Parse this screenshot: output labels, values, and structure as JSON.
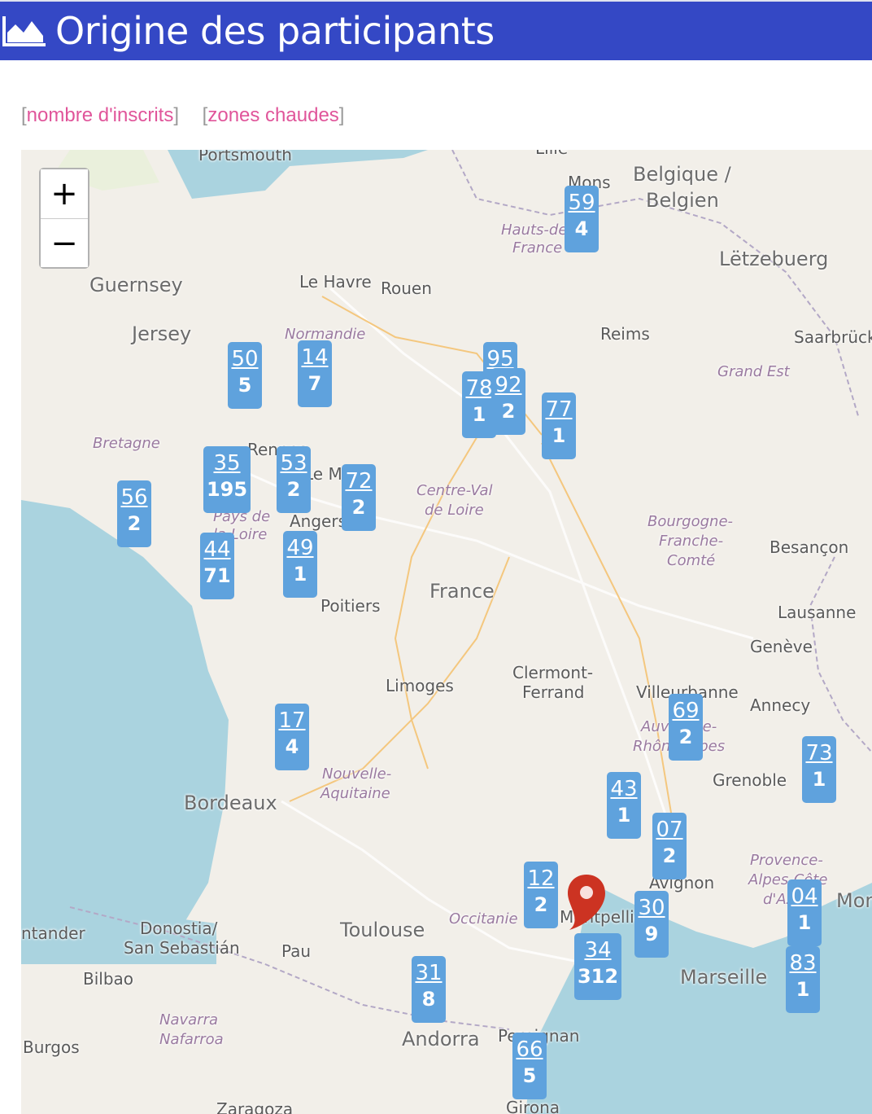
{
  "header": {
    "title": "Origine des participants",
    "icon": "area-chart-icon"
  },
  "filters": {
    "open_bracket": "[",
    "close_bracket": "]",
    "registrations": "nombre d'inscrits",
    "hotspots": "zones chaudes"
  },
  "zoom": {
    "in_label": "+",
    "out_label": "−"
  },
  "map_labels": {
    "portsmouth": "Portsmouth",
    "belgique": "Belgique /",
    "belgien": "Belgien",
    "mons": "Mons",
    "lille": "Lille",
    "guernsey": "Guernsey",
    "jersey": "Jersey",
    "le_havre": "Le Havre",
    "rouen": "Rouen",
    "normandie": "Normandie",
    "hauts_de": "Hauts-de-",
    "france_region": "France",
    "reims": "Reims",
    "letzebuerg": "Lëtzebuerg",
    "saarbrucken": "Saarbrück",
    "grand_est": "Grand Est",
    "bretagne": "Bretagne",
    "rennes": "Rennes",
    "le_mans": "Le Mans",
    "pays_de": "Pays de",
    "la_loire": "la Loire",
    "angers": "Angers",
    "centre_val": "Centre-Val",
    "de_loire": "de Loire",
    "bourgogne": "Bourgogne-",
    "franche": "Franche-",
    "comte": "Comté",
    "besancon": "Besançon",
    "poitiers": "Poitiers",
    "france": "France",
    "lausanne": "Lausanne",
    "geneve": "Genève",
    "limoges": "Limoges",
    "clermont": "Clermont-",
    "ferrand": "Ferrand",
    "villeurbanne": "Villeurbanne",
    "annecy": "Annecy",
    "auvergne": "Auvergne-",
    "rhone_alpes": "Rhône-Alpes",
    "nouvelle": "Nouvelle-",
    "aquitaine": "Aquitaine",
    "grenoble": "Grenoble",
    "bordeaux": "Bordeaux",
    "avignon": "Avignon",
    "provence": "Provence-",
    "alpes_cote": "Alpes-Côte",
    "dazur": "d'Azur",
    "monaco": "Mon",
    "santander": "ntander",
    "donostia": "Donostia/",
    "san_sebastian": "San Sebastián",
    "toulouse": "Toulouse",
    "occitanie": "Occitanie",
    "montpellier": "Montpellier",
    "marseille": "Marseille",
    "pau": "Pau",
    "bilbao": "Bilbao",
    "navarra": "Navarra",
    "nafarroa": "Nafarroa",
    "andorra": "Andorra",
    "perpignan": "Perpignan",
    "burgos": "Burgos",
    "zaragoza": "Zaragoza",
    "girona": "Girona"
  },
  "markers": [
    {
      "code": "59",
      "count": "4"
    },
    {
      "code": "50",
      "count": "5"
    },
    {
      "code": "14",
      "count": "7"
    },
    {
      "code": "95",
      "count": ""
    },
    {
      "code": "78",
      "count": "1"
    },
    {
      "code": "92",
      "count": "2"
    },
    {
      "code": "77",
      "count": "1"
    },
    {
      "code": "35",
      "count": "195"
    },
    {
      "code": "53",
      "count": "2"
    },
    {
      "code": "72",
      "count": "2"
    },
    {
      "code": "56",
      "count": "2"
    },
    {
      "code": "44",
      "count": "71"
    },
    {
      "code": "49",
      "count": "1"
    },
    {
      "code": "17",
      "count": "4"
    },
    {
      "code": "69",
      "count": "2"
    },
    {
      "code": "73",
      "count": "1"
    },
    {
      "code": "43",
      "count": "1"
    },
    {
      "code": "07",
      "count": "2"
    },
    {
      "code": "12",
      "count": "2"
    },
    {
      "code": "30",
      "count": "9"
    },
    {
      "code": "34",
      "count": "312"
    },
    {
      "code": "04",
      "count": "1"
    },
    {
      "code": "83",
      "count": "1"
    },
    {
      "code": "31",
      "count": "8"
    },
    {
      "code": "66",
      "count": "5"
    }
  ],
  "colors": {
    "header_bg": "#3448c5",
    "marker_bg": "#5fa2dd",
    "pin": "#cc3322",
    "link": "#e0559a",
    "sea": "#aad3df"
  }
}
